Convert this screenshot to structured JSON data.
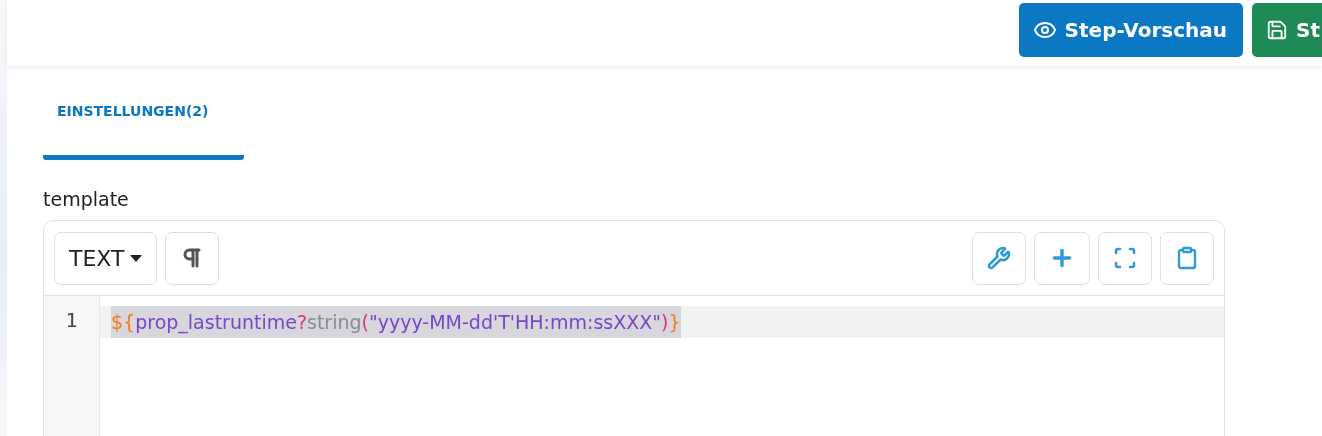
{
  "header": {
    "buttons": [
      {
        "label": "Step-Vorschau",
        "kind": "preview"
      },
      {
        "label": "St",
        "kind": "save"
      }
    ]
  },
  "tabs": [
    {
      "label": "EINSTELLUNGEN(2)",
      "selected": true
    }
  ],
  "field": {
    "label": "template"
  },
  "editor": {
    "mode": "TEXT",
    "lines": [
      {
        "number": "1",
        "active": true,
        "tokens": [
          {
            "text": "${",
            "kind": "delimiter"
          },
          {
            "text": "prop_lastruntime",
            "kind": "variable"
          },
          {
            "text": "?",
            "kind": "operator"
          },
          {
            "text": "string",
            "kind": "builtin"
          },
          {
            "text": "(",
            "kind": "operator"
          },
          {
            "text": "\"yyyy-MM-dd'T'HH:mm:ssXXX\"",
            "kind": "variable"
          },
          {
            "text": ")",
            "kind": "operator"
          },
          {
            "text": "}",
            "kind": "delimiter"
          }
        ]
      }
    ]
  }
}
